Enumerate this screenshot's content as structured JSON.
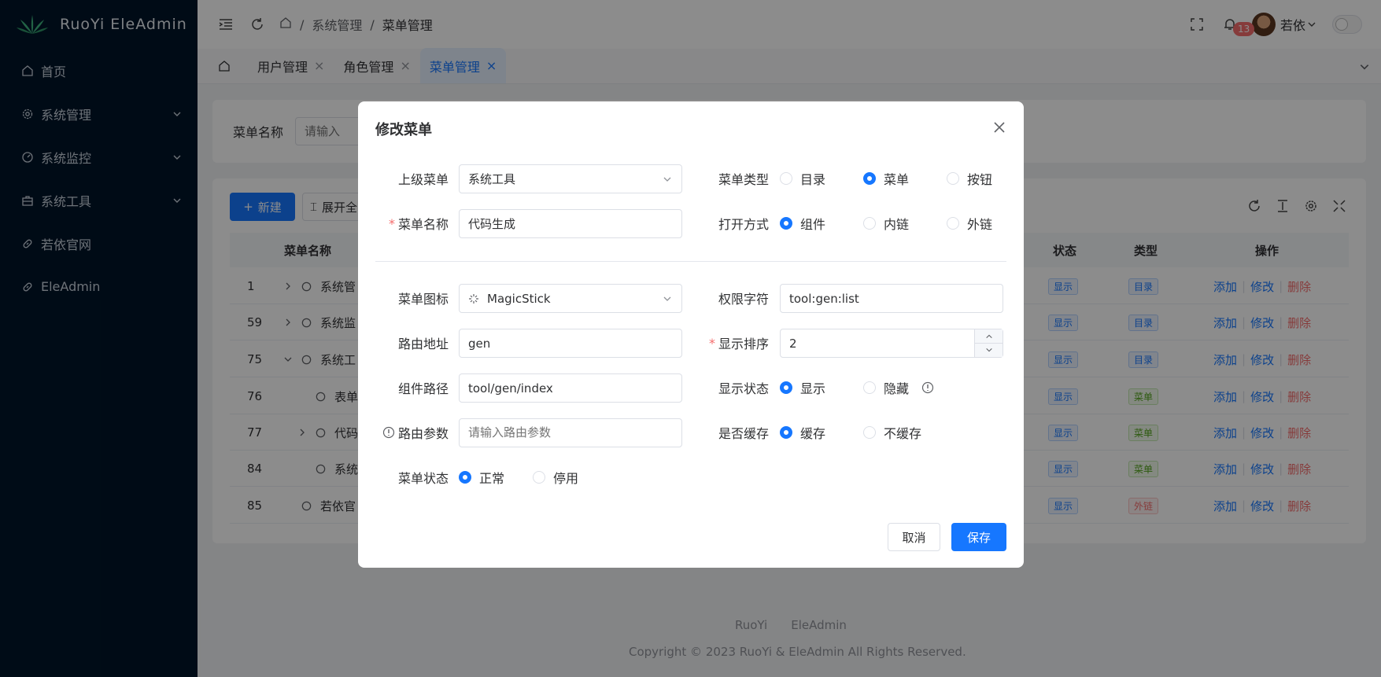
{
  "app": {
    "title": "RuoYi EleAdmin"
  },
  "sidebar": {
    "items": [
      {
        "label": "首页",
        "icon": "home-icon"
      },
      {
        "label": "系统管理",
        "icon": "gear-icon"
      },
      {
        "label": "系统监控",
        "icon": "gauge-icon"
      },
      {
        "label": "系统工具",
        "icon": "toolbox-icon"
      },
      {
        "label": "若依官网",
        "icon": "link-icon"
      },
      {
        "label": "EleAdmin",
        "icon": "link-icon"
      }
    ]
  },
  "header": {
    "breadcrumb": {
      "sep": "/",
      "parent": "系统管理",
      "current": "菜单管理"
    },
    "notification_count": "13",
    "user_name": "若依"
  },
  "tabs": [
    {
      "label": "用户管理"
    },
    {
      "label": "角色管理"
    },
    {
      "label": "菜单管理"
    }
  ],
  "search": {
    "label": "菜单名称",
    "placeholder": "请输入"
  },
  "toolbar": {
    "new_label": "新建",
    "expand_label": "展开全"
  },
  "table": {
    "columns": {
      "name": "菜单名称",
      "status": "状态",
      "type": "类型",
      "actions": "操作"
    },
    "action_labels": {
      "add": "添加",
      "edit": "修改",
      "delete": "删除"
    },
    "rows": [
      {
        "id": "1",
        "name": "系统管",
        "status": "显示",
        "type": "目录",
        "type_color": "blue"
      },
      {
        "id": "59",
        "name": "系统监",
        "status": "显示",
        "type": "目录",
        "type_color": "blue"
      },
      {
        "id": "75",
        "name": "系统工",
        "status": "显示",
        "type": "目录",
        "type_color": "blue"
      },
      {
        "id": "76",
        "name": "表单",
        "status": "显示",
        "type": "菜单",
        "type_color": "green"
      },
      {
        "id": "77",
        "name": "代码",
        "status": "显示",
        "type": "菜单",
        "type_color": "green"
      },
      {
        "id": "84",
        "name": "系统",
        "status": "显示",
        "type": "菜单",
        "type_color": "green"
      },
      {
        "id": "85",
        "name": "若依官",
        "status": "显示",
        "type": "外链",
        "type_color": "red"
      }
    ]
  },
  "footer": {
    "links": [
      "RuoYi",
      "EleAdmin"
    ],
    "copyright": "Copyright © 2023 RuoYi & EleAdmin All Rights Reserved."
  },
  "dialog": {
    "title": "修改菜单",
    "parent_menu": {
      "label": "上级菜单",
      "value": "系统工具"
    },
    "menu_type": {
      "label": "菜单类型",
      "options": [
        "目录",
        "菜单",
        "按钮"
      ],
      "selected": "菜单"
    },
    "menu_name": {
      "label": "菜单名称",
      "value": "代码生成"
    },
    "open_mode": {
      "label": "打开方式",
      "options": [
        "组件",
        "内链",
        "外链"
      ],
      "selected": "组件"
    },
    "menu_icon": {
      "label": "菜单图标",
      "value": "MagicStick"
    },
    "permission": {
      "label": "权限字符",
      "value": "tool:gen:list"
    },
    "route_path": {
      "label": "路由地址",
      "value": "gen"
    },
    "sort_order": {
      "label": "显示排序",
      "value": "2"
    },
    "component_path": {
      "label": "组件路径",
      "value": "tool/gen/index"
    },
    "visible": {
      "label": "显示状态",
      "options": [
        "显示",
        "隐藏"
      ],
      "selected": "显示"
    },
    "route_params": {
      "label": "路由参数",
      "placeholder": "请输入路由参数"
    },
    "cache": {
      "label": "是否缓存",
      "options": [
        "缓存",
        "不缓存"
      ],
      "selected": "缓存"
    },
    "menu_status": {
      "label": "菜单状态",
      "options": [
        "正常",
        "停用"
      ],
      "selected": "正常"
    },
    "cancel_label": "取消",
    "save_label": "保存"
  },
  "colors": {
    "primary": "#1677ff",
    "sidebar_bg": "#001529",
    "danger": "#f56c6c"
  }
}
